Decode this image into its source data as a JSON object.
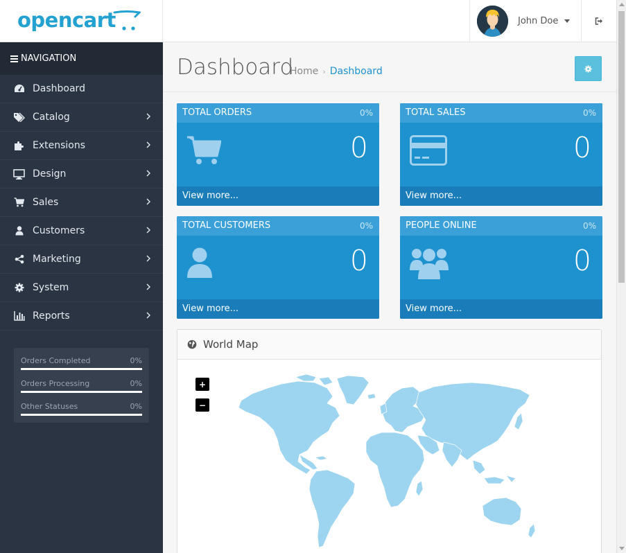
{
  "header": {
    "logo_text": "opencart",
    "user_name": "John Doe"
  },
  "sidebar": {
    "nav_title": "NAVIGATION",
    "items": [
      {
        "label": "Dashboard",
        "icon": "dashboard-icon"
      },
      {
        "label": "Catalog",
        "icon": "tags-icon"
      },
      {
        "label": "Extensions",
        "icon": "puzzle-icon"
      },
      {
        "label": "Design",
        "icon": "monitor-icon"
      },
      {
        "label": "Sales",
        "icon": "cart-icon"
      },
      {
        "label": "Customers",
        "icon": "user-icon"
      },
      {
        "label": "Marketing",
        "icon": "share-icon"
      },
      {
        "label": "System",
        "icon": "gear-icon"
      },
      {
        "label": "Reports",
        "icon": "bar-chart-icon"
      }
    ],
    "stats": [
      {
        "label": "Orders Completed",
        "value": "0%",
        "fraction": 0
      },
      {
        "label": "Orders Processing",
        "value": "0%",
        "fraction": 0
      },
      {
        "label": "Other Statuses",
        "value": "0%",
        "fraction": 0
      }
    ]
  },
  "page": {
    "title": "Dashboard",
    "breadcrumb": [
      "Home",
      "Dashboard"
    ]
  },
  "tiles": [
    {
      "title": "TOTAL ORDERS",
      "percent": "0%",
      "value": "0",
      "footer": "View more...",
      "icon": "shopping-cart-icon"
    },
    {
      "title": "TOTAL SALES",
      "percent": "0%",
      "value": "0",
      "footer": "View more...",
      "icon": "credit-card-icon"
    },
    {
      "title": "TOTAL CUSTOMERS",
      "percent": "0%",
      "value": "0",
      "footer": "View more...",
      "icon": "user-icon"
    },
    {
      "title": "PEOPLE ONLINE",
      "percent": "0%",
      "value": "0",
      "footer": "View more...",
      "icon": "users-icon"
    }
  ],
  "map": {
    "title": "World Map",
    "zoom_in": "+",
    "zoom_out": "−"
  },
  "colors": {
    "brand": "#23a1d1",
    "sidebar_bg": "#2b3442",
    "tile_bg": "#1e91cf",
    "map_land": "#9dd4ef"
  }
}
